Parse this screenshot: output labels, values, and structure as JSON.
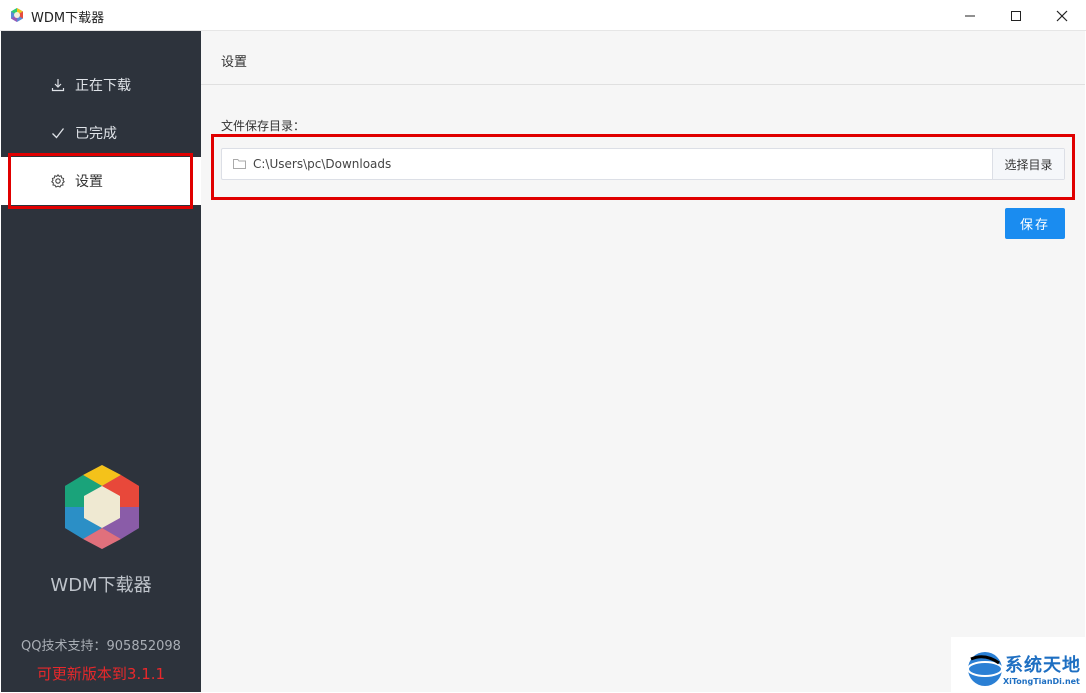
{
  "window": {
    "title": "WDM下载器"
  },
  "sidebar": {
    "items": [
      {
        "label": "正在下载",
        "icon": "download-icon"
      },
      {
        "label": "已完成",
        "icon": "check-icon"
      },
      {
        "label": "设置",
        "icon": "gear-icon"
      }
    ],
    "active_index": 2,
    "brand_name": "WDM下载器",
    "qq_support": "QQ技术支持：905852098",
    "update_notice": "可更新版本到3.1.1"
  },
  "main": {
    "title": "设置",
    "directory_label": "文件保存目录：",
    "directory_value": "C:\\Users\\pc\\Downloads",
    "choose_button": "选择目录",
    "save_button": "保存"
  },
  "watermark": {
    "text": "系统天地",
    "url": "XiTongTianDi.net"
  },
  "colors": {
    "sidebar_bg": "#2d333c",
    "accent": "#1a8cf0",
    "highlight": "#e00000",
    "update_red": "#e8282b"
  }
}
